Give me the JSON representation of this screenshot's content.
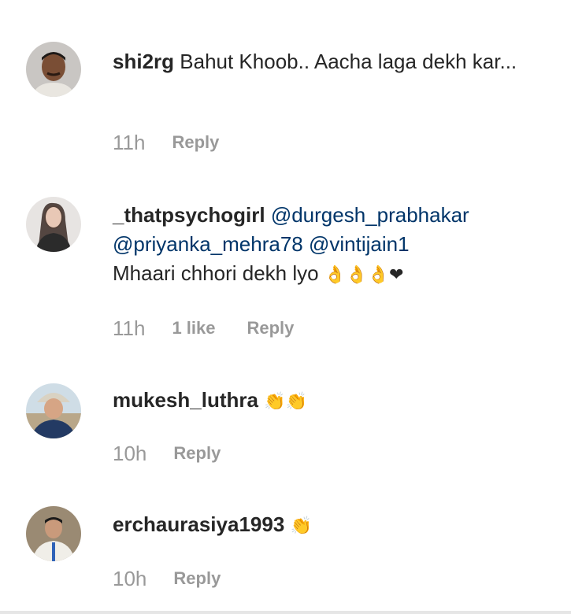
{
  "comments": [
    {
      "username": "shi2rg",
      "text": "Bahut Khoob.. Aacha laga dekh kar...",
      "time": "11h",
      "reply": "Reply"
    },
    {
      "username": "_thatpsychogirl",
      "mention1": "@durgesh_prabhakar",
      "mention2": "@priyanka_mehra78",
      "mention3": "@vintijain1",
      "text": "Mhaari chhori dekh lyo",
      "emoji": "👌👌👌❤",
      "time": "11h",
      "likes": "1 like",
      "reply": "Reply"
    },
    {
      "username": "mukesh_luthra",
      "emoji": "👏👏",
      "time": "10h",
      "reply": "Reply"
    },
    {
      "username": "erchaurasiya1993",
      "emoji": "👏",
      "time": "10h",
      "reply": "Reply"
    }
  ]
}
